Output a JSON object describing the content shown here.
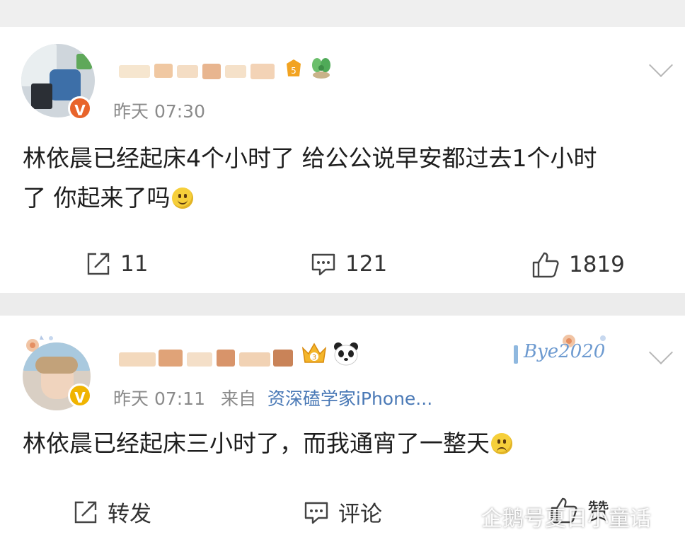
{
  "posts": [
    {
      "time": "昨天 07:30",
      "text_line1": "林依晨已经起床4个小时了 给公公说早安都过去1个小时",
      "text_line2": "了 你起来了吗",
      "actions": {
        "repost": "11",
        "comment": "121",
        "like": "1819"
      },
      "verified_badge": "V",
      "badge_color": "#e8642b"
    },
    {
      "time": "昨天 07:11",
      "from_label": "来自",
      "source": "资深磕学家iPhone...",
      "text": "林依晨已经起床三小时了，而我通宵了一整天",
      "actions": {
        "repost": "转发",
        "comment": "评论",
        "like": "赞"
      },
      "verified_badge": "V",
      "badge_color": "#f0b400",
      "sticker_text": "Bye2020"
    }
  ],
  "watermark": "企鹅号夏日小童话",
  "colors": {
    "meta_gray": "#8a8a8a",
    "source_blue": "#4a79b6",
    "divider": "#ececec"
  }
}
